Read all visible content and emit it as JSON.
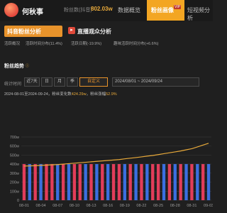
{
  "header": {
    "username": "何秋事",
    "fans_label": "粉丝数(抖音)",
    "fans_value": "802.03w",
    "nav": [
      "数据概览",
      "粉丝画像",
      "短视频分析"
    ],
    "vip_badge": "VIP"
  },
  "card_tabs": {
    "fans_analysis": "抖音粉丝分析",
    "live_analysis": "直播观众分析"
  },
  "sub_tabs": [
    "活跃概况",
    "活跃时间分布(11.4%)",
    "活跃日期(-19.9%)",
    "趣味活跃时间分布(+6.6%)"
  ],
  "section": {
    "title": "粉丝趋势",
    "icon": "info-icon"
  },
  "range": {
    "label": "统计时间",
    "buttons": [
      "近7天",
      "日",
      "月",
      "季",
      "自定义"
    ],
    "active": "自定义",
    "date_from": "2024/08/01",
    "date_sep": "~",
    "date_to": "2024/09/24"
  },
  "summary": {
    "text1": "2024-08-01至2024-09-24，粉丝变化数",
    "change": "424.29w",
    "text2": "，粉丝涨幅",
    "growth": "52.9%"
  },
  "colors": {
    "accent": "#f3a623",
    "line": "#e8a93a",
    "bar_red": "#e23d5a",
    "bar_blue": "#3b6fe0"
  },
  "chart_data": {
    "type": "bar",
    "ylim": [
      0,
      1100
    ],
    "y_ticks": [
      "0",
      "100w",
      "200w",
      "300w",
      "400w",
      "500w",
      "600w",
      "700w"
    ],
    "x_ticks": [
      "08-01",
      "08-04",
      "08-07",
      "08-10",
      "08-13",
      "08-16",
      "08-19",
      "08-22",
      "08-25",
      "08-28",
      "08-31",
      "09-03"
    ],
    "categories": [
      "08-01",
      "08-02",
      "08-03",
      "08-04",
      "08-05",
      "08-06",
      "08-07",
      "08-08",
      "08-09",
      "08-10",
      "08-11",
      "08-12",
      "08-13",
      "08-14",
      "08-15",
      "08-16",
      "08-17",
      "08-18",
      "08-19",
      "08-20",
      "08-21",
      "08-22",
      "08-23",
      "08-24",
      "08-25",
      "08-26",
      "08-27",
      "08-28",
      "08-29",
      "08-30",
      "08-31",
      "09-01",
      "09-02",
      "09-03"
    ],
    "series": [
      {
        "type": "bar",
        "colors": [
          "#e23d5a",
          "#3b6fe0"
        ],
        "values": [
          400,
          400,
          400,
          400,
          400,
          400,
          400,
          400,
          400,
          400,
          400,
          400,
          400,
          400,
          400,
          400,
          400,
          400,
          400,
          400,
          400,
          400,
          400,
          400,
          400,
          400,
          400,
          400,
          400,
          400,
          400,
          400,
          400,
          400
        ]
      },
      {
        "type": "line",
        "values": [
          378,
          380,
          382,
          385,
          388,
          392,
          395,
          400,
          405,
          410,
          415,
          420,
          425,
          430,
          435,
          440,
          445,
          450,
          458,
          465,
          472,
          480,
          488,
          495,
          505,
          515,
          525,
          535,
          545,
          558,
          570,
          590,
          610,
          630
        ]
      }
    ],
    "bar_colors": [
      "#e23d5a",
      "#3b6fe0",
      "#e23d5a",
      "#3b6fe0",
      "#e23d5a",
      "#e23d5a",
      "#3b6fe0",
      "#e23d5a",
      "#3b6fe0",
      "#e23d5a",
      "#e23d5a",
      "#3b6fe0",
      "#e23d5a",
      "#3b6fe0",
      "#e23d5a",
      "#3b6fe0",
      "#e23d5a",
      "#e23d5a",
      "#3b6fe0",
      "#e23d5a",
      "#3b6fe0",
      "#e23d5a",
      "#3b6fe0",
      "#e23d5a",
      "#e23d5a",
      "#3b6fe0",
      "#e23d5a",
      "#3b6fe0",
      "#e23d5a",
      "#3b6fe0",
      "#e23d5a",
      "#3b6fe0",
      "#e23d5a",
      "#3b6fe0"
    ]
  }
}
